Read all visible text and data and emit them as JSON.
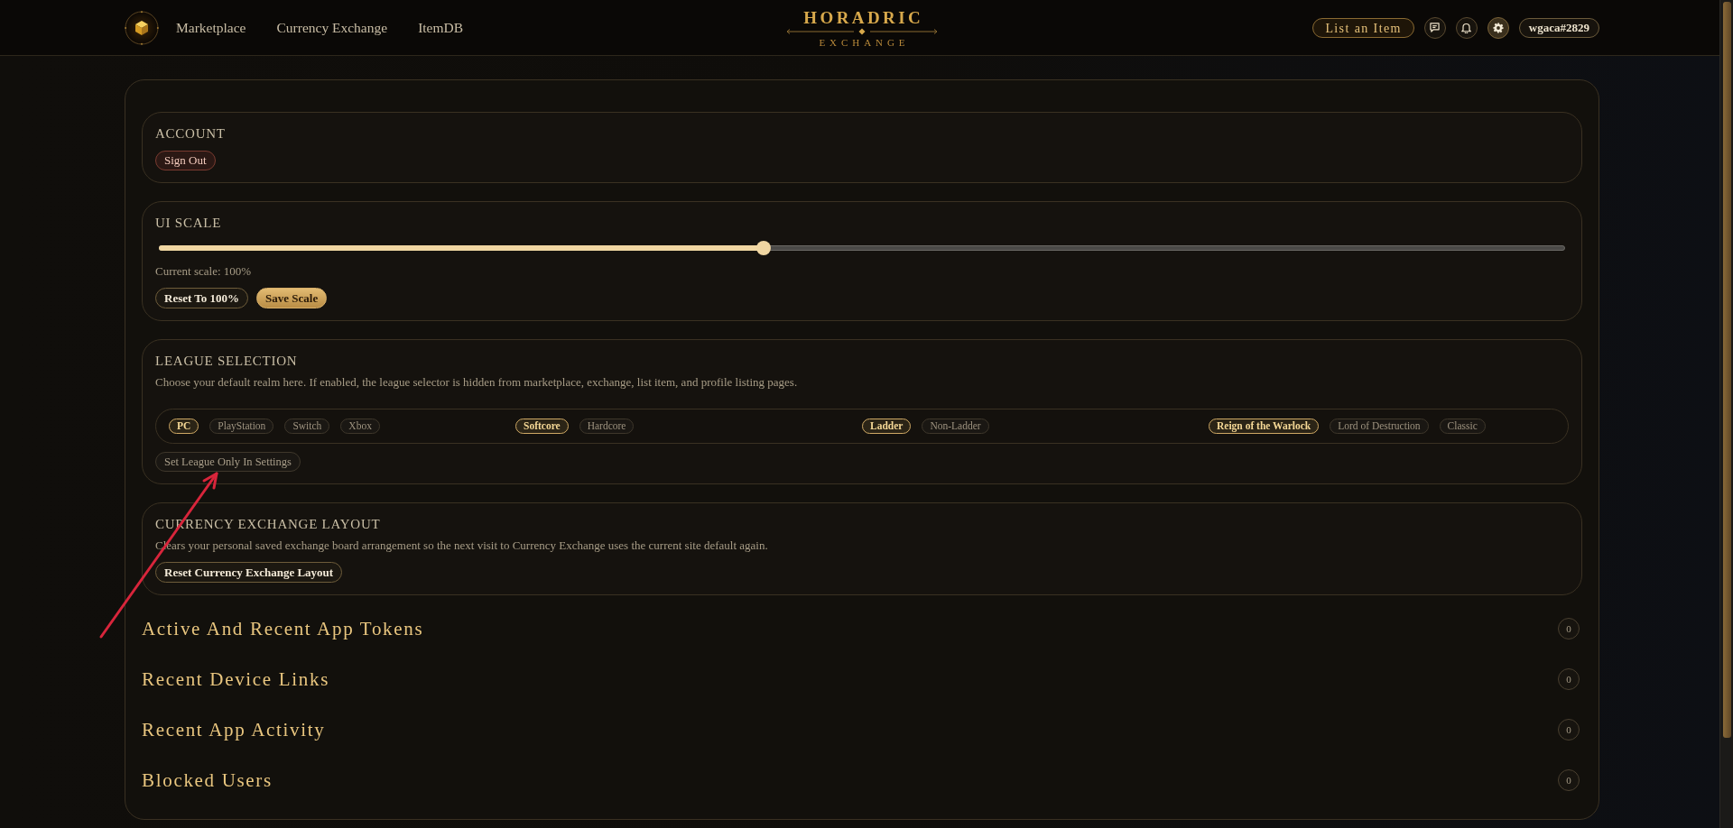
{
  "header": {
    "nav": [
      "Marketplace",
      "Currency Exchange",
      "ItemDB"
    ],
    "brand": {
      "title": "HORADRIC",
      "subtitle": "EXCHANGE"
    },
    "list_button": "List an Item",
    "actions": [
      {
        "kind": "chat",
        "selected": false
      },
      {
        "kind": "bell",
        "selected": false
      },
      {
        "kind": "gear",
        "selected": true
      }
    ],
    "user": "wgaca#2829"
  },
  "cards": [
    {
      "title": "ACCOUNT",
      "buttons": [
        {
          "label": "Sign Out",
          "kind": "danger"
        }
      ]
    },
    {
      "title": "UI SCALE",
      "slider": {
        "level": 0.43
      },
      "reading": "Current scale: 100%",
      "buttons": [
        {
          "label": "Reset To 100%",
          "kind": "outline"
        },
        {
          "label": "Save Scale",
          "kind": "primary"
        }
      ]
    },
    {
      "title": "LEAGUE SELECTION",
      "description": "Choose your default realm here. If enabled, the league selector is hidden from marketplace, exchange, list item, and profile listing pages.",
      "option_groups": [
        {
          "options": [
            {
              "label": "PC",
              "selected": true
            },
            {
              "label": "PlayStation",
              "selected": false
            },
            {
              "label": "Switch",
              "selected": false
            },
            {
              "label": "Xbox",
              "selected": false
            }
          ]
        },
        {
          "options": [
            {
              "label": "Softcore",
              "selected": true
            },
            {
              "label": "Hardcore",
              "selected": false
            }
          ]
        },
        {
          "options": [
            {
              "label": "Ladder",
              "selected": true
            },
            {
              "label": "Non-Ladder",
              "selected": false
            }
          ]
        },
        {
          "options": [
            {
              "label": "Reign of the Warlock",
              "selected": true
            },
            {
              "label": "Lord of Destruction",
              "selected": false
            },
            {
              "label": "Classic",
              "selected": false
            }
          ]
        }
      ],
      "buttons": [
        {
          "label": "Set League Only In Settings",
          "kind": "toggle",
          "on": false
        }
      ]
    },
    {
      "title": "CURRENCY EXCHANGE LAYOUT",
      "description": "Clears your personal saved exchange board arrangement so the next visit to Currency Exchange uses the current site default again.",
      "buttons": [
        {
          "label": "Reset Currency Exchange Layout",
          "kind": "outline"
        }
      ]
    }
  ],
  "sections": [
    {
      "title": "Active And Recent App Tokens",
      "count": "0"
    },
    {
      "title": "Recent Device Links",
      "count": "0"
    },
    {
      "title": "Recent App Activity",
      "count": "0"
    },
    {
      "title": "Blocked Users",
      "count": "0"
    }
  ]
}
